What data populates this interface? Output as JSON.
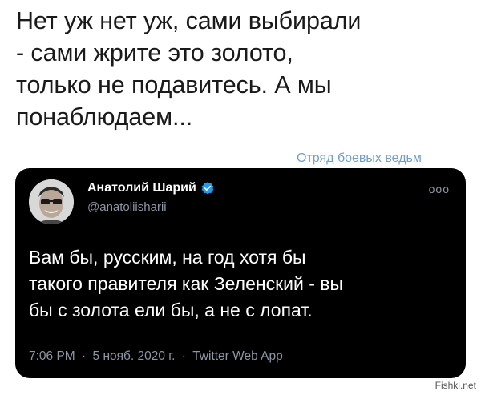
{
  "caption": {
    "lines": [
      "Нет уж нет уж, сами выбирали",
      "- сами жрите это золото,",
      "только не подавитесь. А мы",
      "понаблюдаем..."
    ]
  },
  "watermark_top": "Отряд боевых ведьм",
  "tweet": {
    "author_name": "Анатолий Шарий",
    "handle": "@anatoliisharii",
    "more_label": "ooo",
    "body_lines": [
      "Вам бы, русским, на год хотя бы",
      "такого правителя как Зеленский - вы",
      "бы с золота ели бы, а не с лопат."
    ],
    "time": "7:06 PM",
    "date": "5 нояб. 2020 г.",
    "source": "Twitter Web App",
    "separator": "·",
    "verified_color": "#1d9bf0"
  },
  "watermark_bottom": "Fishki.net"
}
